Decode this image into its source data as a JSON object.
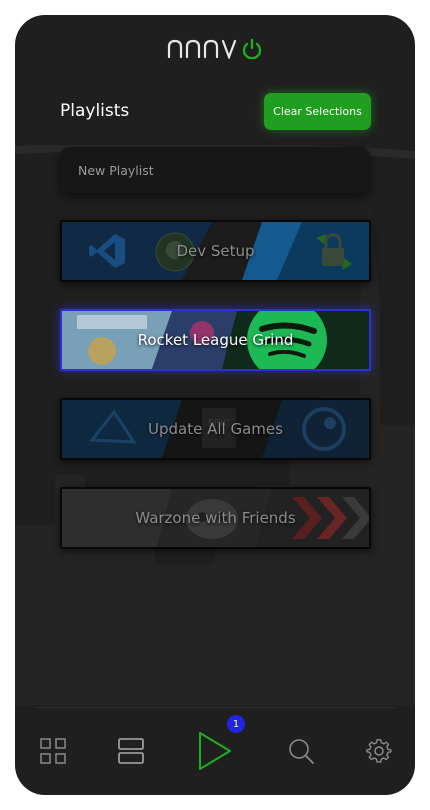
{
  "app": {
    "logo_text": "ANAVO",
    "brand_color": "#1fae1f",
    "accent_blue": "#2323e6"
  },
  "header": {
    "title": "Playlists",
    "clear_label": "Clear Selections"
  },
  "new_playlist": {
    "placeholder": "New Playlist"
  },
  "playlists": [
    {
      "name": "Dev Setup",
      "selected": false,
      "icons": [
        "vscode-icon",
        "github-icon",
        "docker-icon",
        "lock-icon"
      ]
    },
    {
      "name": "Rocket League Grind",
      "selected": true,
      "icons": [
        "rocket-league-icon",
        "spotify-icon"
      ]
    },
    {
      "name": "Update All Games",
      "selected": false,
      "icons": [
        "battlenet-icon",
        "epic-games-icon",
        "steam-icon"
      ]
    },
    {
      "name": "Warzone with Friends",
      "selected": false,
      "icons": [
        "warzone-icon",
        "discord-icon",
        "chevrons-icon"
      ]
    }
  ],
  "nav": {
    "items": [
      "grid-icon",
      "list-icon",
      "play-icon",
      "search-icon",
      "settings-icon"
    ],
    "active": "play-icon",
    "badge_count": "1"
  }
}
